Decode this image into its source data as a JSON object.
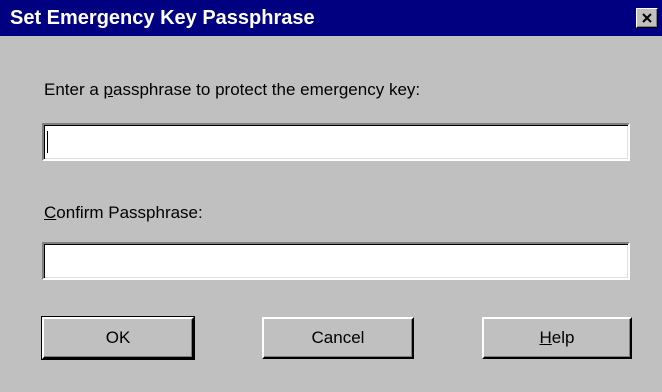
{
  "window": {
    "title": "Set Emergency Key Passphrase",
    "close_icon": "close-x-icon"
  },
  "passphrase": {
    "label_prefix": "Enter a ",
    "label_mnemonic": "p",
    "label_suffix": "assphrase to protect the emergency key:",
    "value": ""
  },
  "confirm": {
    "label_mnemonic": "C",
    "label_suffix": "onfirm Passphrase:",
    "value": ""
  },
  "buttons": {
    "ok_label": "OK",
    "cancel_label": "Cancel",
    "help_mnemonic": "H",
    "help_suffix": "elp"
  }
}
